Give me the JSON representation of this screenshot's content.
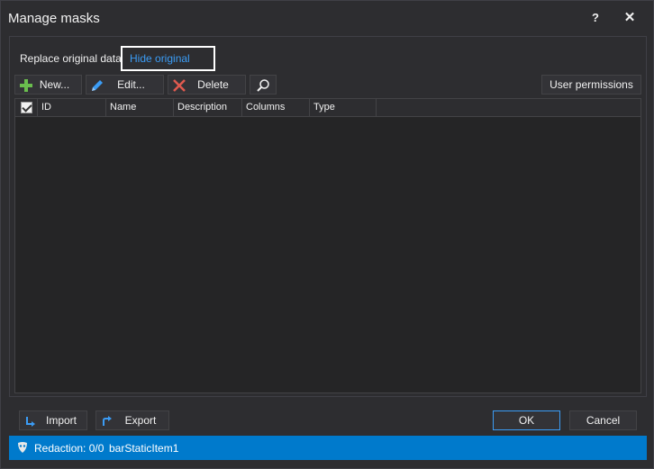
{
  "window": {
    "title": "Manage masks",
    "help_label": "?",
    "close_label": "✕"
  },
  "tabs": [
    {
      "label": "Replace original data",
      "active": false
    },
    {
      "label": "Hide original data",
      "active": true
    }
  ],
  "toolbar": {
    "new_label": "New...",
    "edit_label": "Edit...",
    "delete_label": "Delete",
    "search_icon": "search-icon",
    "user_permissions_label": "User permissions"
  },
  "grid": {
    "columns": [
      "ID",
      "Name",
      "Description",
      "Columns",
      "Type"
    ],
    "rows": []
  },
  "footer": {
    "import_label": "Import",
    "export_label": "Export",
    "ok_label": "OK",
    "cancel_label": "Cancel"
  },
  "status": {
    "redaction_text": "Redaction: 0/0",
    "item_text": "barStaticItem1"
  },
  "colors": {
    "accent": "#3b9cf5",
    "status_bar": "#007acc",
    "add_icon": "#6abe4e",
    "delete_icon": "#e05a4f"
  }
}
